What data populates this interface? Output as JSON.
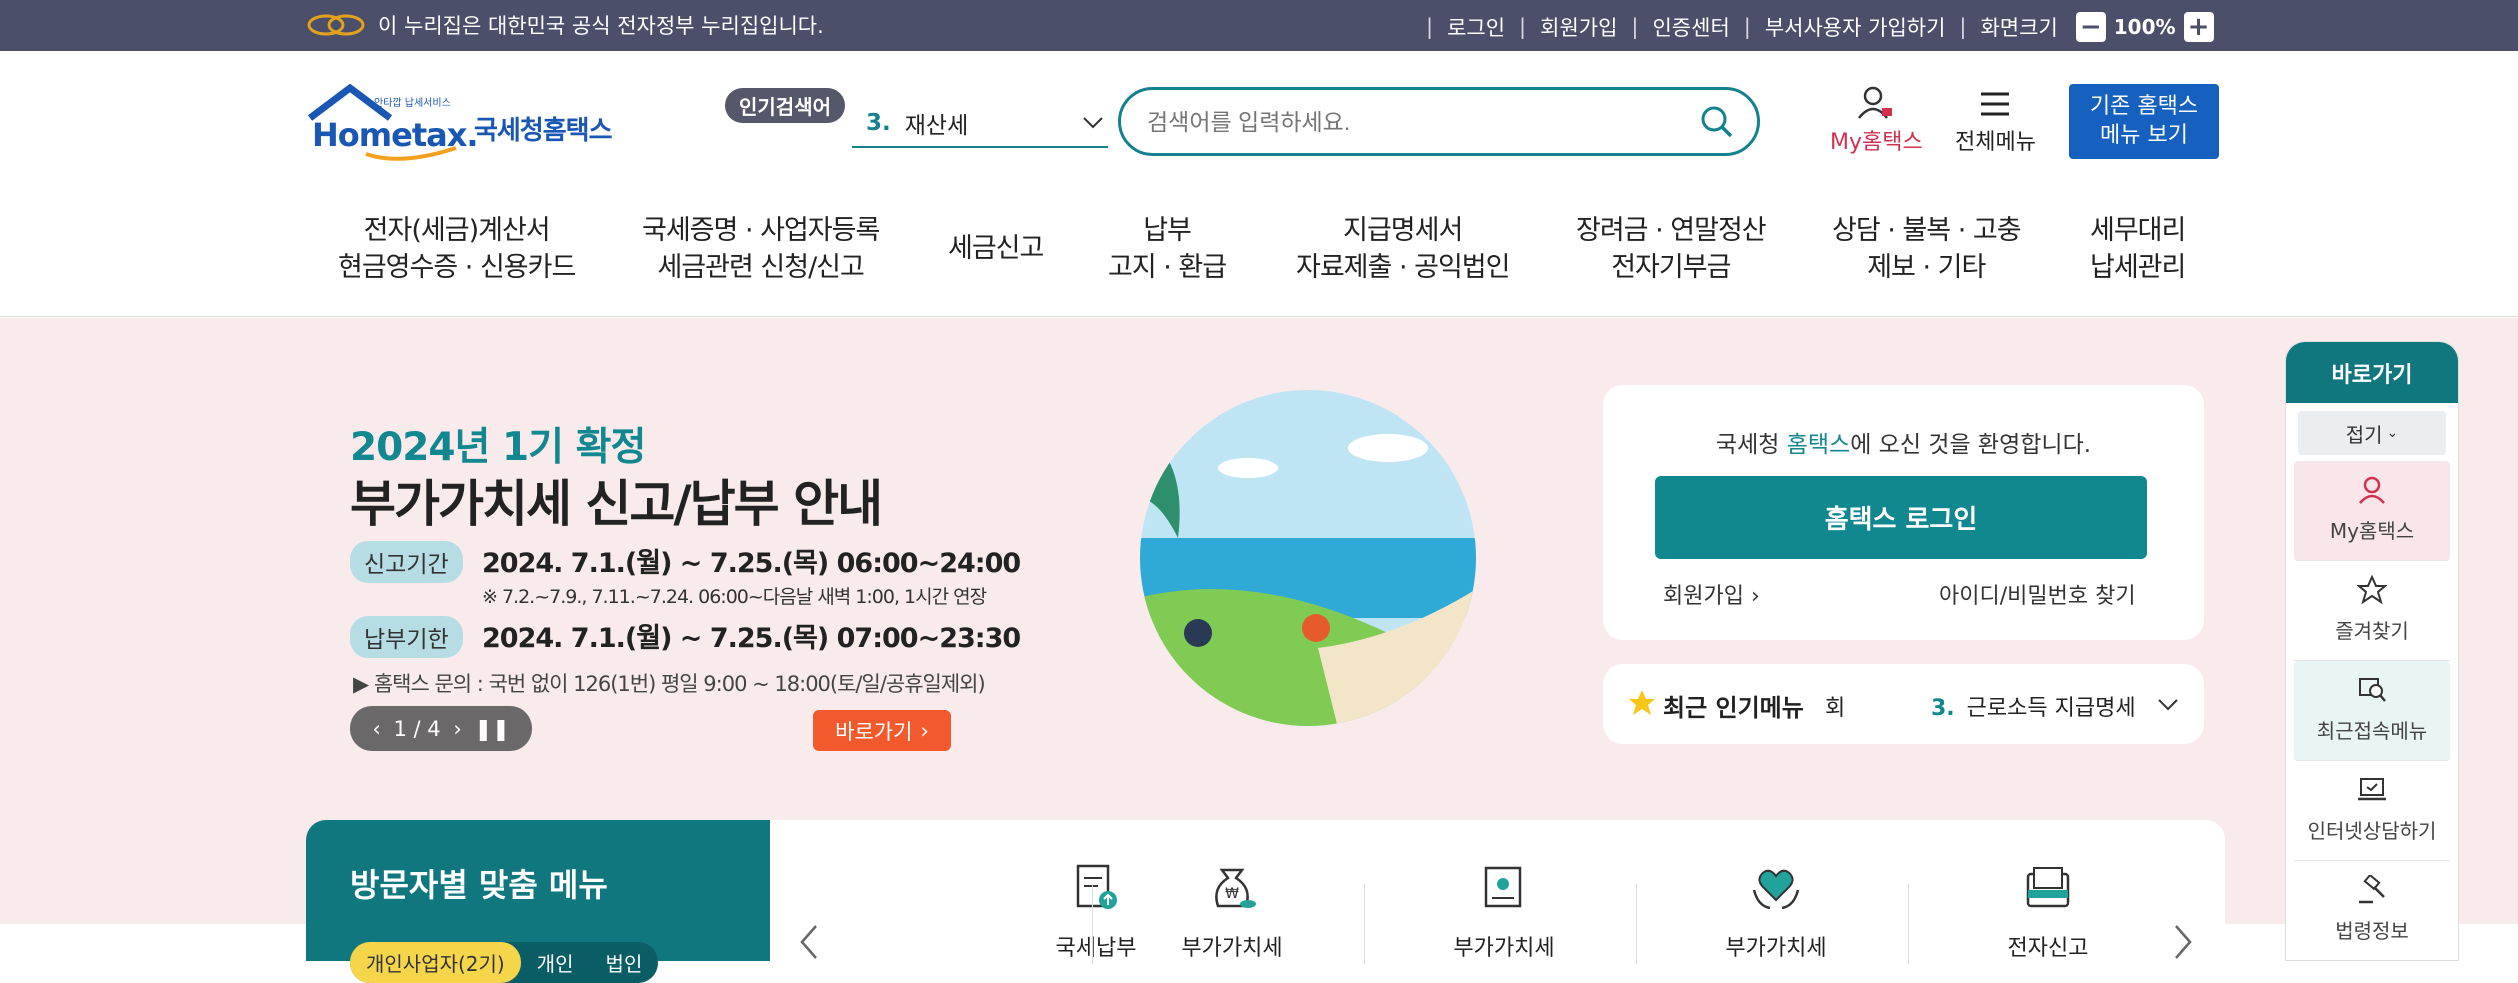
{
  "topbar": {
    "notice": "이 누리집은 대한민국 공식 전자정부 누리집입니다.",
    "links": [
      "로그인",
      "회원가입",
      "인증센터",
      "부서사용자 가입하기",
      "화면크기"
    ],
    "zoom_minus": "−",
    "zoom_value": "100%",
    "zoom_plus": "+"
  },
  "header": {
    "logo_sub": "안타깝 납세서비스",
    "logo_main": "Hometax.",
    "logo_name": "국세청홈택스",
    "popular_label": "인기검색어",
    "popular_rank": "3.",
    "popular_keyword": "재산세",
    "search_placeholder": "검색어를 입력하세요.",
    "my_hometax": "My홈택스",
    "all_menu": "전체메뉴",
    "old_home_line1": "기존 홈택스",
    "old_home_line2": "메뉴 보기"
  },
  "nav": [
    {
      "line1": "전자(세금)계산서",
      "line2": "현금영수증 · 신용카드"
    },
    {
      "line1": "국세증명 · 사업자등록",
      "line2": "세금관련 신청/신고"
    },
    {
      "line1": "세금신고",
      "line2": ""
    },
    {
      "line1": "납부",
      "line2": "고지 · 환급"
    },
    {
      "line1": "지급명세서",
      "line2": "자료제출 · 공익법인"
    },
    {
      "line1": "장려금 · 연말정산",
      "line2": "전자기부금"
    },
    {
      "line1": "상담 · 불복 · 고충",
      "line2": "제보 · 기타"
    },
    {
      "line1": "세무대리",
      "line2": "납세관리"
    }
  ],
  "banner": {
    "title1": "2024년 1기 확정",
    "title2": "부가가치세 신고/납부 안내",
    "label_report": "신고기간",
    "period_report": "2024. 7.1.(월) ~ 7.25.(목) 06:00~24:00",
    "note_report": "※ 7.2.~7.9., 7.11.~7.24. 06:00~다음날 새벽 1:00, 1시간 연장",
    "label_pay": "납부기한",
    "period_pay": "2024. 7.1.(월) ~ 7.25.(목) 07:00~23:30",
    "inquiry": "▶ 홈택스 문의 : 국번 없이 126(1번) 평일 9:00 ~ 18:00(토/일/공휴일제외)",
    "pager_current": "1",
    "pager_total": "4",
    "pager_text": "1 / 4",
    "go_button": "바로가기"
  },
  "login": {
    "welcome_pre": "국세청 ",
    "welcome_hl": "홈택스",
    "welcome_post": "에 오신 것을 환영합니다.",
    "login_button": "홈택스 로그인",
    "signup": "회원가입",
    "find_id": "아이디/비밀번호 찾기"
  },
  "recent": {
    "title": "최근 인기메뉴",
    "fragment": "회",
    "rank": "3.",
    "item": "근로소득 지급명세"
  },
  "quick": {
    "title": "바로가기",
    "fold": "접기",
    "items": [
      "My홈택스",
      "즐겨찾기",
      "최근접속메뉴",
      "인터넷상담하기",
      "법령정보"
    ]
  },
  "visitor": {
    "title": "방문자별 맞춤 메뉴",
    "tabs": [
      "개인사업자(2기)",
      "개인",
      "법인"
    ]
  },
  "services": [
    "국세납부",
    "부가가치세",
    "부가가치세",
    "부가가치세",
    "전자신고"
  ],
  "colors": {
    "teal": "#11878f",
    "topbar": "#4b4f6a",
    "hero_bg": "#f9ebec",
    "orange": "#f25a2d",
    "blue": "#1660c0"
  }
}
